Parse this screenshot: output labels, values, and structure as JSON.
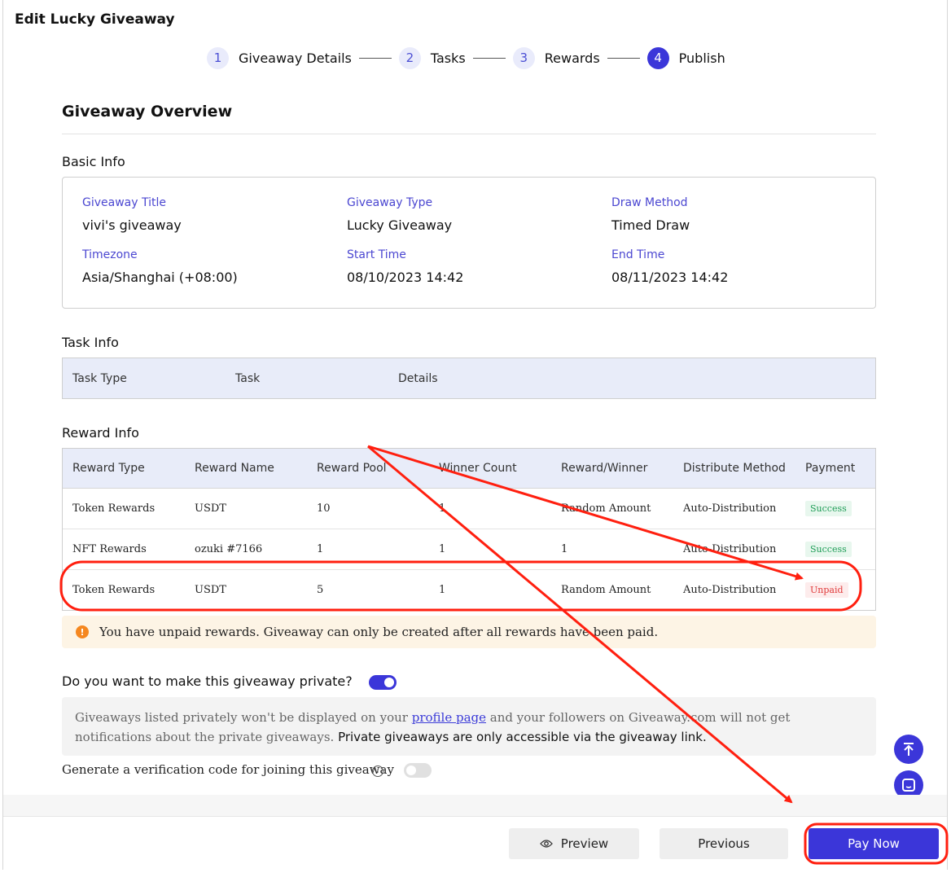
{
  "page_title": "Edit Lucky Giveaway",
  "stepper": [
    {
      "num": "1",
      "label": "Giveaway Details"
    },
    {
      "num": "2",
      "label": "Tasks"
    },
    {
      "num": "3",
      "label": "Rewards"
    },
    {
      "num": "4",
      "label": "Publish"
    }
  ],
  "overview_title": "Giveaway Overview",
  "basic_info": {
    "heading": "Basic Info",
    "fields": [
      {
        "label": "Giveaway Title",
        "value": "vivi's giveaway"
      },
      {
        "label": "Giveaway Type",
        "value": "Lucky Giveaway"
      },
      {
        "label": "Draw Method",
        "value": "Timed Draw"
      },
      {
        "label": "Timezone",
        "value": "Asia/Shanghai (+08:00)"
      },
      {
        "label": "Start Time",
        "value": "08/10/2023 14:42"
      },
      {
        "label": "End Time",
        "value": "08/11/2023 14:42"
      }
    ]
  },
  "task_info": {
    "heading": "Task Info",
    "columns": [
      "Task Type",
      "Task",
      "Details"
    ]
  },
  "reward_info": {
    "heading": "Reward Info",
    "columns": [
      "Reward Type",
      "Reward Name",
      "Reward Pool",
      "Winner Count",
      "Reward/Winner",
      "Distribute Method",
      "Payment"
    ],
    "rows": [
      [
        "Token Rewards",
        "USDT",
        "10",
        "1",
        "Random Amount",
        "Auto-Distribution",
        "Success"
      ],
      [
        "NFT Rewards",
        "ozuki #7166",
        "1",
        "1",
        "1",
        "Auto-Distribution",
        "Success"
      ],
      [
        "Token Rewards",
        "USDT",
        "5",
        "1",
        "Random Amount",
        "Auto-Distribution",
        "Unpaid"
      ]
    ]
  },
  "warning": {
    "icon": "!",
    "text": "You have unpaid rewards. Giveaway can only be created after all rewards have been paid."
  },
  "private": {
    "question": "Do you want to make this giveaway private?",
    "enabled": true,
    "info_part1": "Giveaways listed privately won't be displayed on your ",
    "info_link": "profile page",
    "info_part2": " and your followers on Giveaway.com will not get notifications about the private giveaways. ",
    "info_bold": "Private giveaways are only accessible via the giveaway link."
  },
  "verification": {
    "label": "Generate a verification code for joining this giveaway",
    "info_icon": "i",
    "enabled": false
  },
  "buttons": {
    "preview": "Preview",
    "previous": "Previous",
    "pay_now": "Pay Now"
  },
  "colors": {
    "accent": "#3b36d9",
    "annotation": "#ff1f0f",
    "success": "#1f9d57",
    "unpaid": "#e03a3a"
  }
}
